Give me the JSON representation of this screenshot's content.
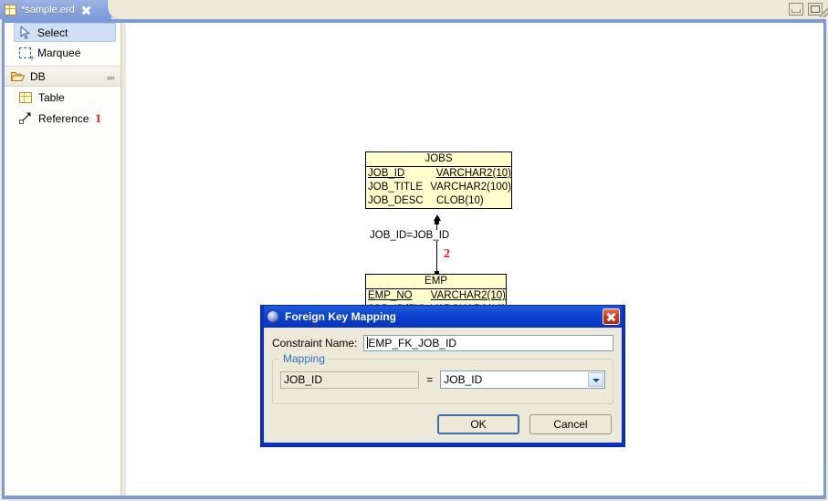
{
  "window": {
    "minimize_label": "Minimize",
    "maximize_label": "Maximize"
  },
  "tab": {
    "title": "*sample.erd",
    "icon": "table-grid-icon",
    "close_icon": "close-icon"
  },
  "palette": {
    "tools": [
      {
        "label": "Select",
        "icon": "cursor-arrow-icon",
        "selected": true
      },
      {
        "label": "Marquee",
        "icon": "marquee-select-icon",
        "selected": false
      }
    ],
    "drawer": {
      "label": "DB",
      "icon": "open-folder-icon",
      "collapse_icon": "collapse-chevrons-icon"
    },
    "items": [
      {
        "label": "Table",
        "icon": "table-grid-icon",
        "annotation": ""
      },
      {
        "label": "Reference",
        "icon": "reference-arrow-icon",
        "annotation": "1"
      }
    ]
  },
  "canvas": {
    "entities": [
      {
        "name": "JOBS",
        "attributes": [
          {
            "name": "JOB_ID",
            "type": "VARCHAR2(10)",
            "key": true
          },
          {
            "name": "JOB_TITLE",
            "type": "VARCHAR2(100)",
            "key": false
          },
          {
            "name": "JOB_DESC",
            "type": "CLOB(10)",
            "key": false
          }
        ]
      },
      {
        "name": "EMP",
        "attributes": [
          {
            "name": "EMP_NO",
            "type": "VARCHAR2(10)",
            "key": true
          },
          {
            "name": "JOB_ID(FK)",
            "type": "VARCHAR2(10)",
            "key": true
          }
        ]
      }
    ],
    "connection": {
      "label": "JOB_ID=JOB_ID",
      "annotation": "2"
    }
  },
  "dialog": {
    "title": "Foreign Key Mapping",
    "icon": "globe-icon",
    "close_icon": "close-icon",
    "constraint": {
      "label": "Constraint Name:",
      "value": "EMP_FK_JOB_ID",
      "placeholder": ""
    },
    "mapping": {
      "legend": "Mapping",
      "source_value": "JOB_ID",
      "equals": "=",
      "target_value": "JOB_ID",
      "dropdown_icon": "chevron-down-icon"
    },
    "buttons": {
      "ok": "OK",
      "cancel": "Cancel"
    }
  },
  "colors": {
    "tab_blue": "#7e99d8",
    "entity_fill": "#ffffcc",
    "dialog_blue": "#0a2fd0",
    "annotation_red": "#ee1111",
    "selection_blue": "#cfe0f5"
  }
}
